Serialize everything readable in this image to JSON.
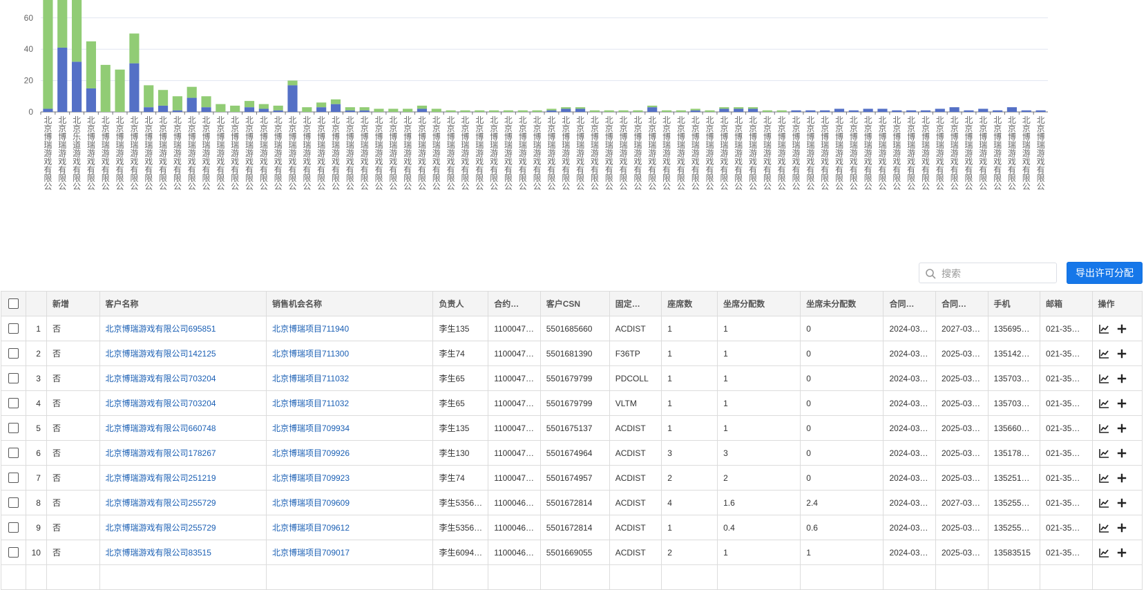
{
  "chart_data": {
    "type": "bar",
    "stacked": true,
    "grid": true,
    "y_ticks": [
      0,
      20,
      40,
      60
    ],
    "ylim": [
      0,
      72
    ],
    "category_label": "北京博瑞游戏有限公",
    "special_category_label": "北京乐道游戏有限公",
    "special_category_index": 2,
    "series": [
      {
        "color": "#5470c6",
        "values": [
          2,
          41,
          32,
          15,
          0,
          0,
          31,
          3,
          4,
          1,
          9,
          3,
          0,
          0,
          3,
          2,
          1,
          17,
          0,
          3,
          5,
          1,
          1,
          0,
          0,
          0,
          2,
          0,
          0,
          0,
          0,
          0,
          0,
          0,
          0,
          1,
          2,
          2,
          0,
          0,
          0,
          0,
          3,
          0,
          0,
          1,
          0,
          2,
          2,
          2,
          0,
          0,
          1,
          1,
          1,
          2,
          1,
          2,
          2,
          1,
          1,
          1,
          2,
          3,
          1,
          2,
          1,
          3,
          1,
          1
        ]
      },
      {
        "color": "#91cc75",
        "values": [
          72,
          72,
          72,
          30,
          30,
          27,
          19,
          14,
          10,
          9,
          7,
          7,
          5,
          4,
          4,
          3,
          3,
          3,
          3,
          3,
          3,
          2,
          2,
          2,
          2,
          2,
          2,
          2,
          1,
          1,
          1,
          1,
          1,
          1,
          1,
          1,
          1,
          1,
          1,
          1,
          1,
          1,
          1,
          1,
          1,
          1,
          1,
          1,
          1,
          1,
          1,
          1,
          0,
          0,
          0,
          0,
          0,
          0,
          0,
          0,
          0,
          0,
          0,
          0,
          0,
          0,
          0,
          0,
          0,
          0
        ]
      }
    ]
  },
  "toolbar": {
    "search_placeholder": "搜索",
    "export_label": "导出许可分配"
  },
  "table": {
    "headers": [
      "新增",
      "客户名称",
      "销售机会名称",
      "负责人",
      "合约…",
      "客户CSN",
      "固定…",
      "座席数",
      "坐席分配数",
      "坐席未分配数",
      "合同…",
      "合同…",
      "手机",
      "邮箱",
      "操作"
    ],
    "rows": [
      {
        "no": "1",
        "new": "否",
        "customer": "北京博瑞游戏有限公司695851",
        "opportunity": "北京博瑞项目711940",
        "owner": "李生135",
        "contract": "1100047…",
        "csn": "5501685660",
        "fixed": "ACDIST",
        "seats": "1",
        "assigned": "1",
        "unassigned": "0",
        "start": "2024-03…",
        "end": "2027-03…",
        "phone": "135695…",
        "email": "021-35…"
      },
      {
        "no": "2",
        "new": "否",
        "customer": "北京博瑞游戏有限公司142125",
        "opportunity": "北京博瑞项目711300",
        "owner": "李生74",
        "contract": "1100047…",
        "csn": "5501681390",
        "fixed": "F36TP",
        "seats": "1",
        "assigned": "1",
        "unassigned": "0",
        "start": "2024-03…",
        "end": "2025-03…",
        "phone": "135142…",
        "email": "021-35…"
      },
      {
        "no": "3",
        "new": "否",
        "customer": "北京博瑞游戏有限公司703204",
        "opportunity": "北京博瑞项目711032",
        "owner": "李生65",
        "contract": "1100047…",
        "csn": "5501679799",
        "fixed": "PDCOLL",
        "seats": "1",
        "assigned": "1",
        "unassigned": "0",
        "start": "2024-03…",
        "end": "2025-03…",
        "phone": "135703…",
        "email": "021-35…"
      },
      {
        "no": "4",
        "new": "否",
        "customer": "北京博瑞游戏有限公司703204",
        "opportunity": "北京博瑞项目711032",
        "owner": "李生65",
        "contract": "1100047…",
        "csn": "5501679799",
        "fixed": "VLTM",
        "seats": "1",
        "assigned": "1",
        "unassigned": "0",
        "start": "2024-03…",
        "end": "2025-03…",
        "phone": "135703…",
        "email": "021-35…"
      },
      {
        "no": "5",
        "new": "否",
        "customer": "北京博瑞游戏有限公司660748",
        "opportunity": "北京博瑞项目709934",
        "owner": "李生135",
        "contract": "1100047…",
        "csn": "5501675137",
        "fixed": "ACDIST",
        "seats": "1",
        "assigned": "1",
        "unassigned": "0",
        "start": "2024-03…",
        "end": "2025-03…",
        "phone": "135660…",
        "email": "021-35…"
      },
      {
        "no": "6",
        "new": "否",
        "customer": "北京博瑞游戏有限公司178267",
        "opportunity": "北京博瑞项目709926",
        "owner": "李生130",
        "contract": "1100047…",
        "csn": "5501674964",
        "fixed": "ACDIST",
        "seats": "3",
        "assigned": "3",
        "unassigned": "0",
        "start": "2024-03…",
        "end": "2025-03…",
        "phone": "135178…",
        "email": "021-35…"
      },
      {
        "no": "7",
        "new": "否",
        "customer": "北京博瑞游戏有限公司251219",
        "opportunity": "北京博瑞项目709923",
        "owner": "李生74",
        "contract": "1100047…",
        "csn": "5501674957",
        "fixed": "ACDIST",
        "seats": "2",
        "assigned": "2",
        "unassigned": "0",
        "start": "2024-03…",
        "end": "2025-03…",
        "phone": "135251…",
        "email": "021-35…"
      },
      {
        "no": "8",
        "new": "否",
        "customer": "北京博瑞游戏有限公司255729",
        "opportunity": "北京博瑞项目709609",
        "owner": "李生5356…",
        "contract": "1100046…",
        "csn": "5501672814",
        "fixed": "ACDIST",
        "seats": "4",
        "assigned": "1.6",
        "unassigned": "2.4",
        "start": "2024-03…",
        "end": "2027-03…",
        "phone": "135255…",
        "email": "021-35…"
      },
      {
        "no": "9",
        "new": "否",
        "customer": "北京博瑞游戏有限公司255729",
        "opportunity": "北京博瑞项目709612",
        "owner": "李生5356…",
        "contract": "1100046…",
        "csn": "5501672814",
        "fixed": "ACDIST",
        "seats": "1",
        "assigned": "0.4",
        "unassigned": "0.6",
        "start": "2024-03…",
        "end": "2025-03…",
        "phone": "135255…",
        "email": "021-35…"
      },
      {
        "no": "10",
        "new": "否",
        "customer": "北京博瑞游戏有限公司83515",
        "opportunity": "北京博瑞项目709017",
        "owner": "李生6094…",
        "contract": "1100046…",
        "csn": "5501669055",
        "fixed": "ACDIST",
        "seats": "2",
        "assigned": "1",
        "unassigned": "1",
        "start": "2024-03…",
        "end": "2025-03…",
        "phone": "13583515",
        "email": "021-35…"
      }
    ]
  }
}
